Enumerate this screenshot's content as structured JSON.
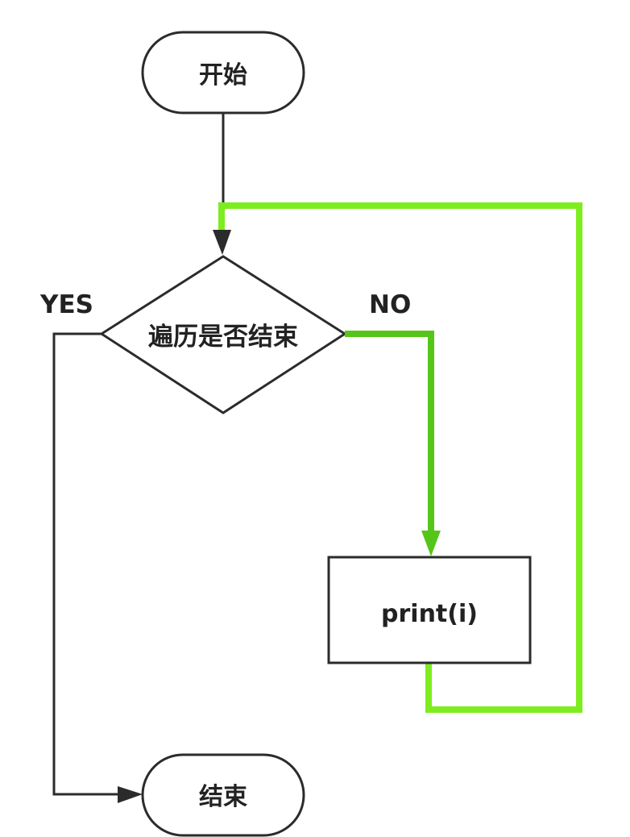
{
  "flowchart": {
    "start_label": "开始",
    "decision_label": "遍历是否结束",
    "yes_label": "YES",
    "no_label": "NO",
    "process_label": "print(i)",
    "end_label": "结束"
  },
  "colors": {
    "stroke": "#2b2b2b",
    "no_branch": "#56c51a",
    "loop_back": "#7ded1f"
  }
}
